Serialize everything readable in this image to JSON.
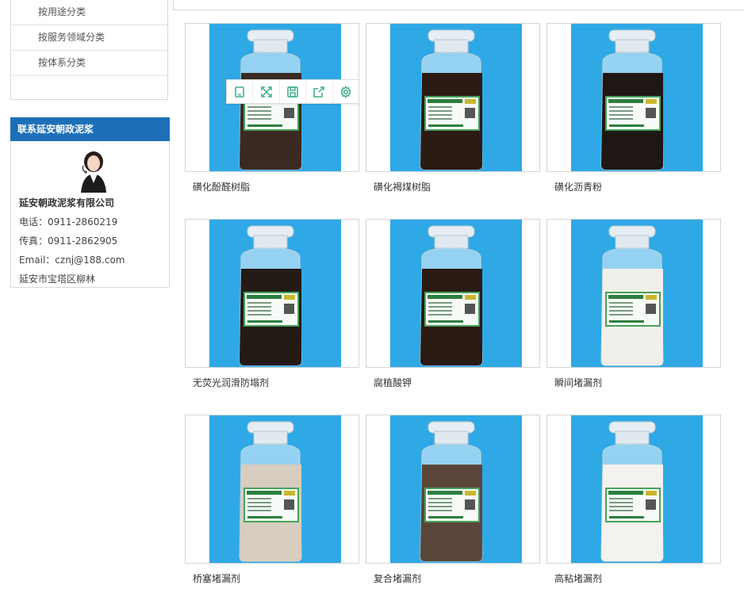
{
  "sidebar": {
    "categories": [
      {
        "label": "按用途分类"
      },
      {
        "label": "按服务领域分类"
      },
      {
        "label": "按体系分类"
      }
    ],
    "contact": {
      "heading": "联系延安朝政泥浆",
      "company": "延安朝政泥浆有限公司",
      "phone": "电话：0911-2860219",
      "fax": "传真：0911-2862905",
      "email": "Email：cznj@188.com",
      "address": "延安市宝塔区柳林"
    }
  },
  "products": [
    {
      "name": "磺化酚醛树脂",
      "powder": "#3a2a22",
      "bg": "#2ea9e6"
    },
    {
      "name": "磺化褐煤树脂",
      "powder": "#2b1b13",
      "bg": "#2ea9e6"
    },
    {
      "name": "磺化沥青粉",
      "powder": "#1f1713",
      "bg": "#2ea9e6"
    },
    {
      "name": "无荧光润滑防塌剂",
      "powder": "#231a16",
      "bg": "#2ea9e6"
    },
    {
      "name": "腐植酸钾",
      "powder": "#2a1a12",
      "bg": "#2ea9e6"
    },
    {
      "name": "瞬间堵漏剂",
      "powder": "#f1efe9",
      "bg": "#2ea9e6"
    },
    {
      "name": "桥塞堵漏剂",
      "powder": "#d8cdbf",
      "bg": "#2ea9e6"
    },
    {
      "name": "复合堵漏剂",
      "powder": "#5a4638",
      "bg": "#2ea9e6"
    },
    {
      "name": "高粘堵漏剂",
      "powder": "#f4f2ee",
      "bg": "#2ea9e6"
    }
  ],
  "toolbar": {
    "icons": [
      "copy-icon",
      "fullscreen-icon",
      "save-icon",
      "share-icon",
      "settings-icon"
    ]
  },
  "colors": {
    "accent": "#1d6fb8",
    "toolbar_icon": "#3aaf82"
  }
}
